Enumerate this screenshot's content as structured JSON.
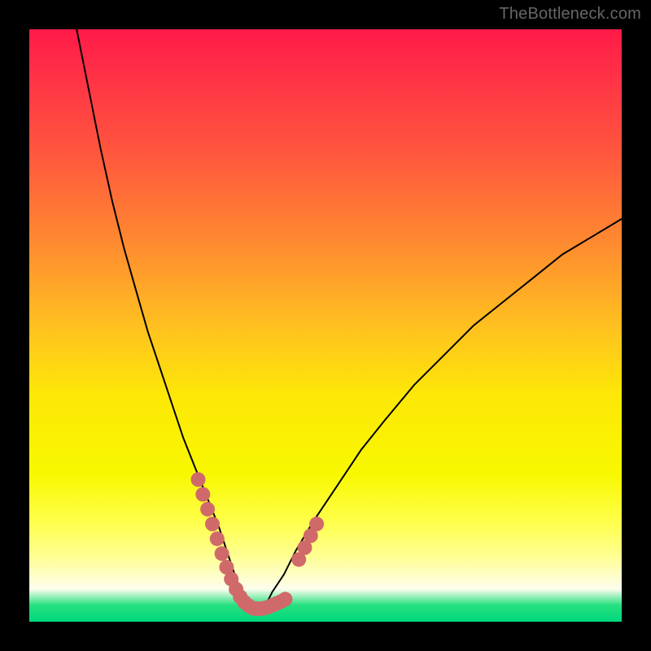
{
  "watermark": "TheBottleneck.com",
  "chart_data": {
    "type": "line",
    "title": "",
    "xlabel": "",
    "ylabel": "",
    "xlim": [
      0,
      100
    ],
    "ylim": [
      0,
      100
    ],
    "curve": {
      "x": [
        8,
        10,
        12,
        14,
        16,
        18,
        20,
        22,
        24,
        26,
        28,
        30,
        32,
        33,
        34,
        35,
        36,
        37,
        38,
        39,
        40,
        41,
        43,
        45,
        48,
        52,
        56,
        60,
        65,
        70,
        75,
        80,
        85,
        90,
        95,
        100
      ],
      "y": [
        100,
        90,
        80,
        71,
        63,
        56,
        49,
        43,
        37,
        31,
        26,
        21,
        16,
        13,
        10,
        7,
        5,
        3,
        2,
        2,
        3,
        5,
        8,
        12,
        17,
        23,
        29,
        34,
        40,
        45,
        50,
        54,
        58,
        62,
        65,
        68
      ]
    },
    "marker_segments": [
      {
        "x": [
          28.5,
          29.3,
          30.1,
          30.9,
          31.7,
          32.5,
          33.3,
          34.1,
          34.9,
          35.6,
          36.3,
          37.0,
          37.7,
          38.3
        ],
        "y": [
          24.0,
          21.5,
          19.0,
          16.5,
          14.0,
          11.5,
          9.2,
          7.2,
          5.5,
          4.2,
          3.3,
          2.7,
          2.3,
          2.2
        ]
      },
      {
        "x": [
          38.3,
          39.0,
          39.7,
          40.4,
          41.1,
          41.8,
          42.5,
          43.2
        ],
        "y": [
          2.2,
          2.2,
          2.3,
          2.5,
          2.8,
          3.1,
          3.4,
          3.8
        ]
      },
      {
        "x": [
          45.5,
          46.5,
          47.5,
          48.5
        ],
        "y": [
          10.5,
          12.5,
          14.5,
          16.5
        ]
      }
    ],
    "marker_color": "#d06a6a",
    "curve_color": "#000000"
  }
}
